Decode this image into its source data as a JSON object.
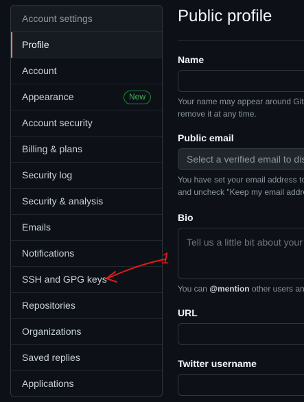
{
  "sidebar": {
    "header": "Account settings",
    "items": [
      {
        "label": "Profile"
      },
      {
        "label": "Account"
      },
      {
        "label": "Appearance",
        "badge": "New"
      },
      {
        "label": "Account security"
      },
      {
        "label": "Billing & plans"
      },
      {
        "label": "Security log"
      },
      {
        "label": "Security & analysis"
      },
      {
        "label": "Emails"
      },
      {
        "label": "Notifications"
      },
      {
        "label": "SSH and GPG keys"
      },
      {
        "label": "Repositories"
      },
      {
        "label": "Organizations"
      },
      {
        "label": "Saved replies"
      },
      {
        "label": "Applications"
      }
    ],
    "selected": "Profile"
  },
  "main": {
    "title": "Public profile",
    "name": {
      "label": "Name",
      "note_line1": "Your name may appear around Gith",
      "note_line2": "remove it at any time."
    },
    "public_email": {
      "label": "Public email",
      "placeholder": "Select a verified email to dis",
      "note_line1": "You have set your email address to",
      "note_line2": "and uncheck \"Keep my email addre"
    },
    "bio": {
      "label": "Bio",
      "placeholder": "Tell us a little bit about your",
      "note_prefix": "You can ",
      "note_mention": "@mention",
      "note_suffix": " other users and"
    },
    "url": {
      "label": "URL"
    },
    "twitter": {
      "label": "Twitter username"
    }
  },
  "annotation": {
    "number": "1",
    "color": "#e01b1b"
  },
  "colors": {
    "background": "#0d1117",
    "accent_selected": "#f78166",
    "badge_green": "#3fb950"
  }
}
